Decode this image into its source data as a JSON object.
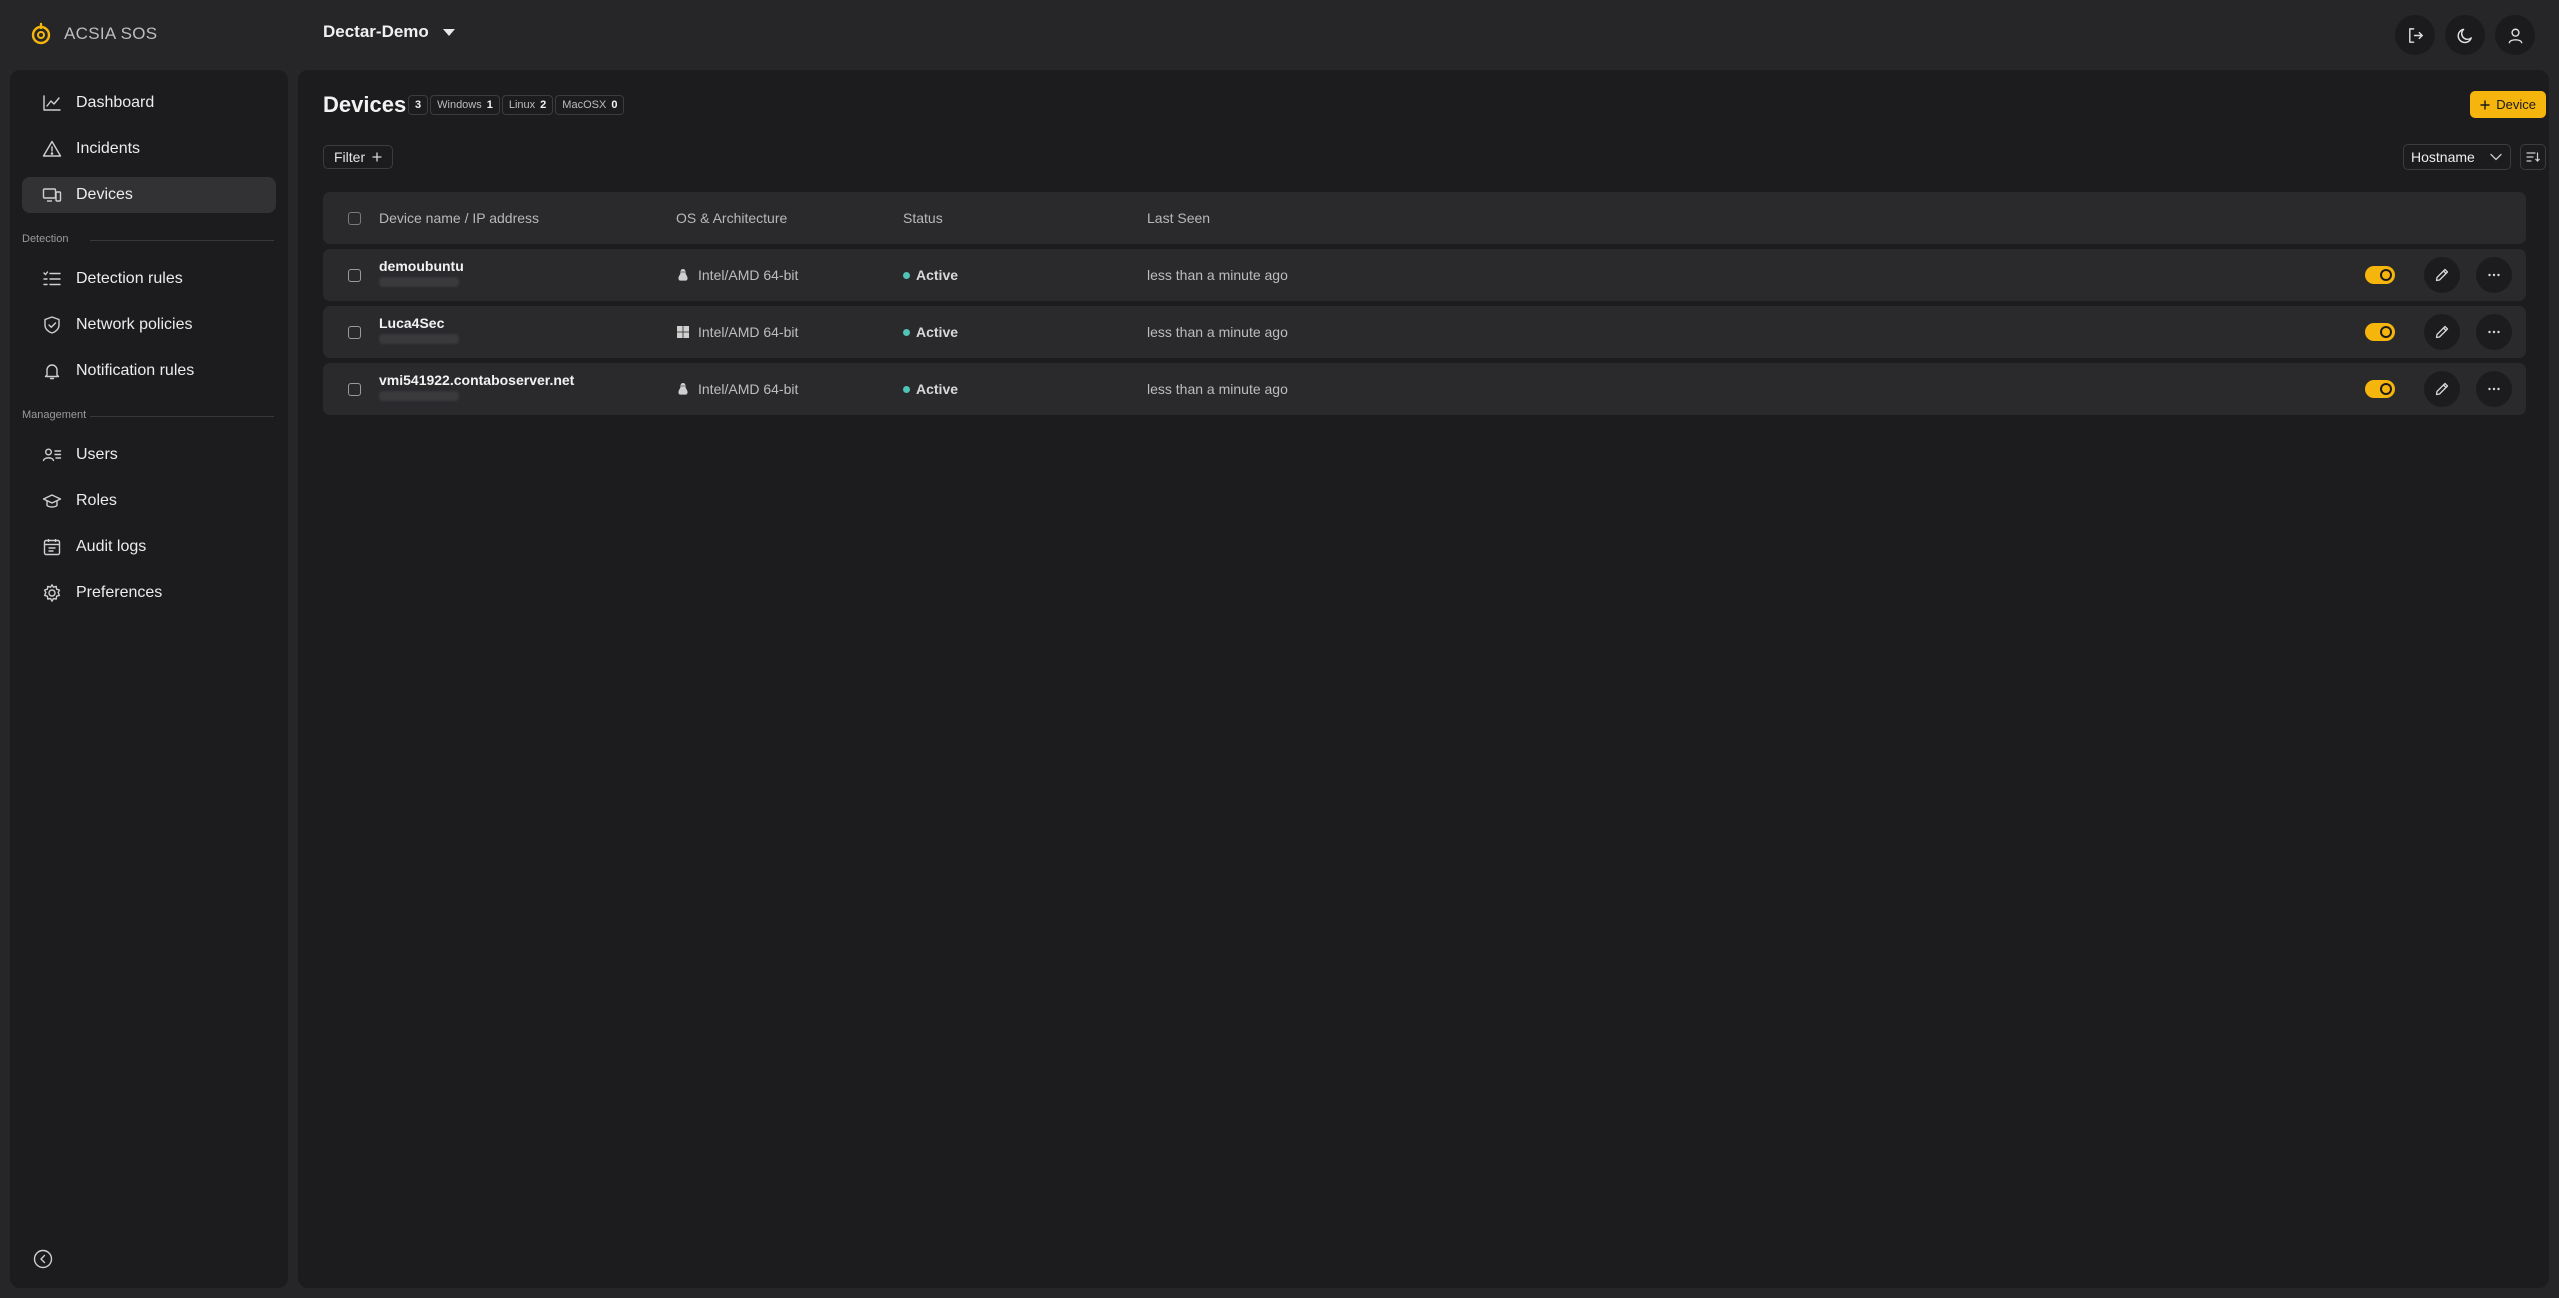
{
  "brand": {
    "name": "ACSIA SOS",
    "accent": "#f5b50c"
  },
  "workspace": {
    "name": "Dectar-Demo"
  },
  "topbar": {
    "icons": [
      "logout-icon",
      "moon-icon",
      "user-icon"
    ]
  },
  "sidebar": {
    "items": [
      {
        "label": "Dashboard",
        "icon": "chart-line-icon"
      },
      {
        "label": "Incidents",
        "icon": "warning-triangle-icon"
      },
      {
        "label": "Devices",
        "icon": "devices-icon",
        "active": true
      }
    ],
    "detection_label": "Detection",
    "detection_items": [
      {
        "label": "Detection rules",
        "icon": "list-check-icon"
      },
      {
        "label": "Network policies",
        "icon": "shield-check-icon"
      },
      {
        "label": "Notification rules",
        "icon": "bell-icon"
      }
    ],
    "management_label": "Management",
    "management_items": [
      {
        "label": "Users",
        "icon": "users-icon"
      },
      {
        "label": "Roles",
        "icon": "graduation-cap-icon"
      },
      {
        "label": "Audit logs",
        "icon": "calendar-log-icon"
      },
      {
        "label": "Preferences",
        "icon": "gear-icon"
      }
    ]
  },
  "page": {
    "title": "Devices",
    "counts": {
      "total": "3",
      "windows_label": "Windows",
      "windows": "1",
      "linux_label": "Linux",
      "linux": "2",
      "macosx_label": "MacOSX",
      "macosx": "0"
    },
    "add_button": "Device",
    "filter_label": "Filter",
    "sort_value": "Hostname"
  },
  "table": {
    "headers": {
      "name": "Device name / IP address",
      "os": "OS & Architecture",
      "status": "Status",
      "last_seen": "Last Seen"
    },
    "rows": [
      {
        "name": "demoubuntu",
        "os_icon": "linux-icon",
        "arch": "Intel/AMD 64-bit",
        "status": "Active",
        "last_seen": "less than a minute ago",
        "enabled": true
      },
      {
        "name": "Luca4Sec",
        "os_icon": "windows-icon",
        "arch": "Intel/AMD 64-bit",
        "status": "Active",
        "last_seen": "less than a minute ago",
        "enabled": true
      },
      {
        "name": "vmi541922.contaboserver.net",
        "os_icon": "linux-icon",
        "arch": "Intel/AMD 64-bit",
        "status": "Active",
        "last_seen": "less than a minute ago",
        "enabled": true
      }
    ]
  }
}
